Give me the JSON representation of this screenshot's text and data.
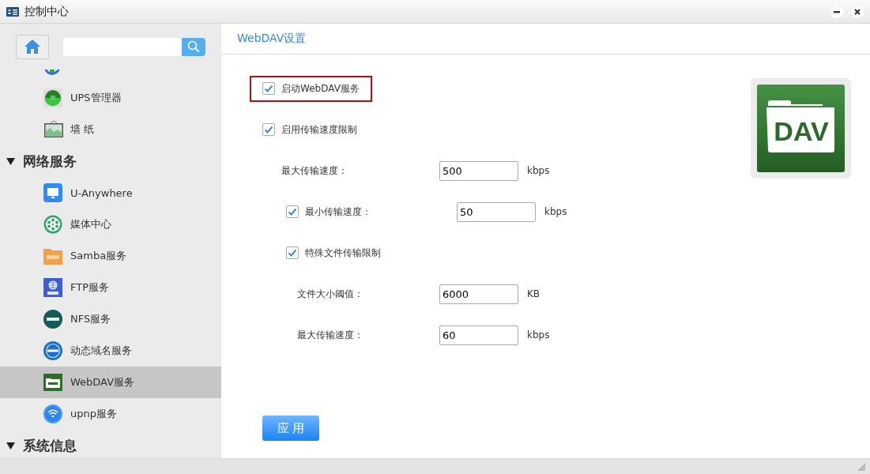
{
  "window": {
    "title": "控制中心"
  },
  "sidebar": {
    "groups": [
      {
        "children": [
          {
            "label": "UPS管理器",
            "selected": false
          },
          {
            "label": "墙 纸",
            "selected": false
          }
        ]
      },
      {
        "label": "网络服务",
        "expanded": true,
        "children": [
          {
            "label": "U-Anywhere",
            "selected": false
          },
          {
            "label": "媒体中心",
            "selected": false
          },
          {
            "label": "Samba服务",
            "selected": false
          },
          {
            "label": "FTP服务",
            "selected": false
          },
          {
            "label": "NFS服务",
            "selected": false
          },
          {
            "label": "动态域名服务",
            "selected": false
          },
          {
            "label": "WebDAV服务",
            "selected": true
          },
          {
            "label": "upnp服务",
            "selected": false
          }
        ]
      },
      {
        "label": "系统信息",
        "expanded": true
      }
    ]
  },
  "content": {
    "title": "WebDAV设置",
    "options": [
      {
        "kind": "checkbox",
        "label": "启动WebDAV服务",
        "checked": true,
        "highlighted": true
      },
      {
        "kind": "checkbox",
        "label": "启用传输速度限制",
        "checked": true,
        "highlighted": false,
        "children": [
          {
            "kind": "field",
            "label": "最大传输速度：",
            "value": "500",
            "unit": "kbps"
          },
          {
            "kind": "checkbox",
            "label": "最小传输速度：",
            "checked": true,
            "highlighted": false,
            "value": "50",
            "unit": "kbps"
          },
          {
            "kind": "checkbox",
            "label": "特殊文件传输限制",
            "checked": true,
            "highlighted": false,
            "children": [
              {
                "kind": "field",
                "label": "文件大小阈值：",
                "value": "6000",
                "unit": "KB"
              },
              {
                "kind": "field",
                "label": "最大传输速度：",
                "value": "60",
                "unit": "kbps"
              }
            ]
          }
        ]
      }
    ],
    "apply_button": "应 用",
    "logo_text": "DAV"
  }
}
